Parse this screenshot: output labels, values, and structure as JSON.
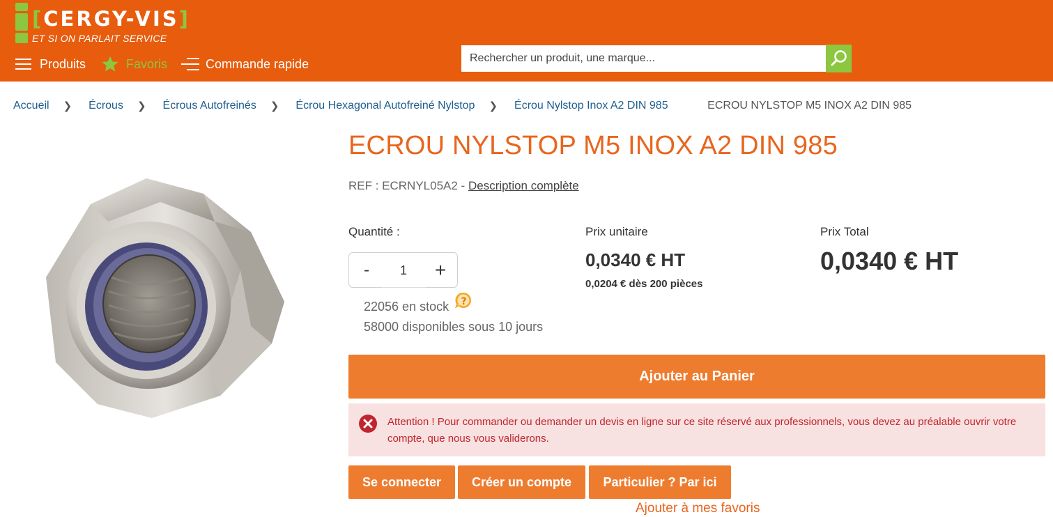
{
  "header": {
    "logo_text": "CERGY-VIS",
    "logo_bracket_left": "[",
    "logo_bracket_right": "]",
    "tagline": "ET SI ON PARLAIT SERVICE",
    "nav": {
      "produits": "Produits",
      "favoris": "Favoris",
      "commande_rapide": "Commande rapide"
    },
    "search_placeholder": "Rechercher un produit, une marque..."
  },
  "breadcrumb": {
    "items": [
      "Accueil",
      "Écrous",
      "Écrous Autofreinés",
      "Écrou Hexagonal Autofreiné Nylstop",
      "Écrou Nylstop Inox A2 DIN 985"
    ],
    "current": "ECROU NYLSTOP M5 INOX A2 DIN 985"
  },
  "product": {
    "title": "ECROU NYLSTOP M5 INOX A2 DIN 985",
    "ref_text": "REF : ECRNYL05A2 -",
    "description_link": "Description complète",
    "quantity_label": "Quantité :",
    "quantity_minus": "-",
    "quantity_plus": "+",
    "quantity_value": "1",
    "stock": "22056 en stock",
    "disponibles": "58000 disponibles sous 10 jours",
    "unit_price_label": "Prix unitaire",
    "unit_price": "0,0340 € HT",
    "degressive": "0,0204 € dès 200 pièces",
    "total_label": "Prix Total",
    "total_price": "0,0340 € HT"
  },
  "actions": {
    "add_to_cart": "Ajouter au Panier",
    "alert": "Attention ! Pour commander ou demander un devis en ligne sur ce site réservé aux professionnels, vous devez au préalable ouvrir votre compte, que nous vous validerons.",
    "login": "Se connecter",
    "create_account": "Créer un compte",
    "particulier": "Particulier ? Par ici",
    "add_favorites": "Ajouter à mes favoris"
  },
  "colors": {
    "header_orange": "#e85c0d",
    "accent_green": "#8dc63f",
    "button_orange": "#ee7c2f",
    "title_orange": "#e8651e",
    "alert_bg": "#f8e1e1",
    "alert_text": "#c0262d",
    "link_blue": "#1d5e8e"
  },
  "icons": [
    "menu-icon",
    "star-icon",
    "quick-order-icon",
    "search-icon",
    "chevron-right-icon",
    "help-icon",
    "error-icon"
  ]
}
